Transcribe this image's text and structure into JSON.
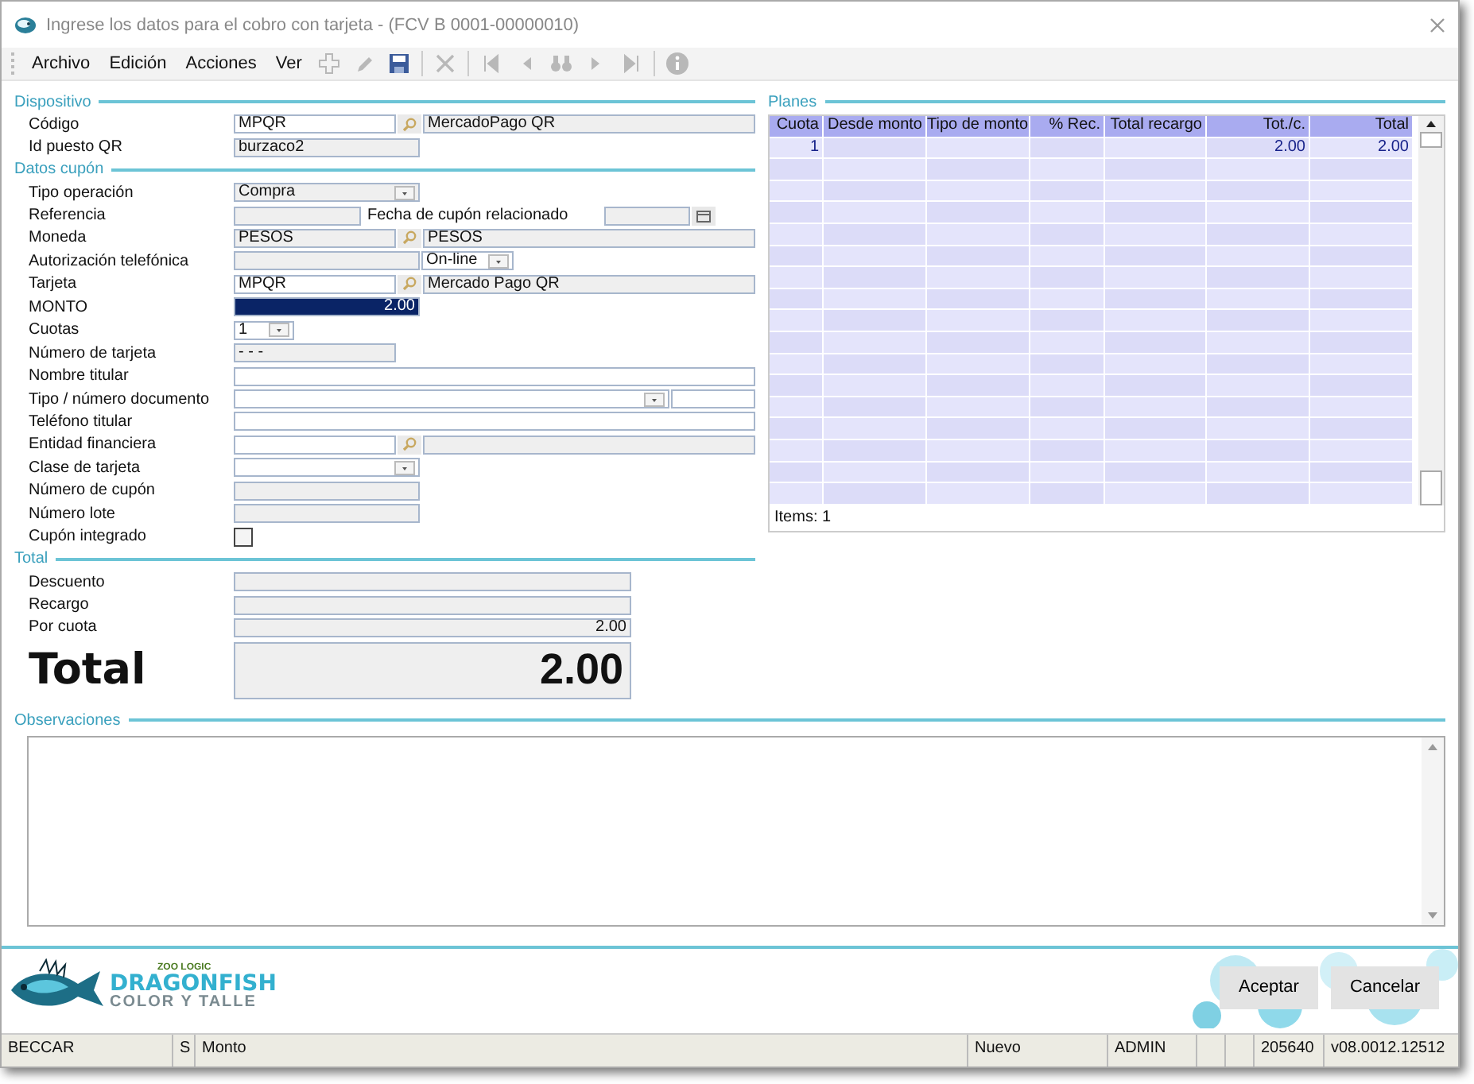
{
  "window": {
    "title": "Ingrese los datos para el cobro con tarjeta - (FCV B 0001-00000010)"
  },
  "menu": [
    "Archivo",
    "Edición",
    "Acciones",
    "Ver"
  ],
  "tools": [
    {
      "kind": "add",
      "disabled": true
    },
    {
      "kind": "edit",
      "disabled": true
    },
    {
      "kind": "save",
      "disabled": false
    },
    {
      "kind": "sep"
    },
    {
      "kind": "delete",
      "disabled": true
    },
    {
      "kind": "sep"
    },
    {
      "kind": "first",
      "disabled": true
    },
    {
      "kind": "prev",
      "disabled": true
    },
    {
      "kind": "find",
      "disabled": true
    },
    {
      "kind": "next",
      "disabled": true
    },
    {
      "kind": "last",
      "disabled": true
    },
    {
      "kind": "sep"
    },
    {
      "kind": "info",
      "disabled": true
    }
  ],
  "sections": [
    {
      "title": "Dispositivo",
      "rows": [
        {
          "label": "Código",
          "kind": "lookup",
          "value": "MPQR",
          "disabled": false,
          "description": "MercadoPago QR"
        },
        {
          "label": "Id puesto QR",
          "kind": "text",
          "value": "burzaco2",
          "disabled": true
        }
      ]
    },
    {
      "title": "Datos cupón",
      "rows": [
        {
          "label": "Tipo operación",
          "kind": "select",
          "value": "Compra",
          "disabled": true
        },
        {
          "label": "Referencia",
          "kind": "reference",
          "disabled": true,
          "related_label": "Fecha de cupón relacionado"
        },
        {
          "label": "Moneda",
          "kind": "lookup",
          "value": "PESOS",
          "disabled": true,
          "description": "PESOS"
        },
        {
          "label": "Autorización telefónica",
          "kind": "auth",
          "disabled": true,
          "option": "On-line"
        },
        {
          "label": "Tarjeta",
          "kind": "lookup",
          "value": "MPQR",
          "disabled": false,
          "description": "Mercado Pago QR"
        },
        {
          "label": "MONTO",
          "kind": "money",
          "value": "2.00",
          "disabled": false,
          "selected": true
        },
        {
          "label": "Cuotas",
          "kind": "count",
          "value": "1",
          "disabled": false
        },
        {
          "label": "Número de tarjeta",
          "kind": "card",
          "value": "-   -   -",
          "disabled": true
        },
        {
          "label": "Nombre titular",
          "kind": "wide",
          "disabled": false
        },
        {
          "label": "Tipo / número documento",
          "kind": "document",
          "disabled": false
        },
        {
          "label": "Teléfono titular",
          "kind": "wide",
          "disabled": false
        },
        {
          "label": "Entidad financiera",
          "kind": "lookup",
          "disabled": false
        },
        {
          "label": "Clase de tarjeta",
          "kind": "select",
          "disabled": false
        },
        {
          "label": "Número de cupón",
          "kind": "text",
          "disabled": true
        },
        {
          "label": "Número lote",
          "kind": "text",
          "disabled": true
        },
        {
          "label": "Cupón integrado",
          "kind": "check",
          "checked": false
        }
      ]
    }
  ],
  "total": {
    "title": "Total",
    "rows": [
      {
        "label": "Descuento"
      },
      {
        "label": "Recargo"
      },
      {
        "label": "Por cuota",
        "value": "2.00"
      }
    ],
    "total_label": "Total",
    "total_value": "2.00"
  },
  "plans": {
    "title": "Planes",
    "columns": [
      "Cuota",
      "Desde monto",
      "Tipo de monto",
      "% Rec.",
      "Total recargo",
      "Tot./c.",
      "Total"
    ],
    "rows": [
      [
        "1",
        "",
        "",
        "",
        "",
        "2.00",
        "2.00"
      ]
    ],
    "items": "Items: 1"
  },
  "notes": {
    "title": "Observaciones"
  },
  "logo": {
    "maker": "ZOO LOGIC",
    "name": "DRAGONFISH",
    "tagline": "COLOR Y TALLE"
  },
  "buttons": [
    "Aceptar",
    "Cancelar"
  ],
  "status_bar": [
    "BECCAR",
    "S",
    "Monto",
    "Nuevo",
    "ADMIN",
    "205640",
    "v08.0012.12512"
  ]
}
